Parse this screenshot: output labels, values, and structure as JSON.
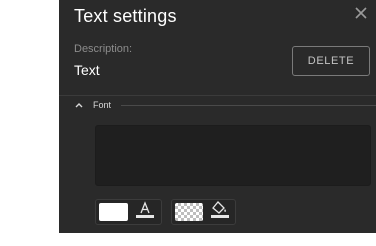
{
  "dialog": {
    "title": "Text settings",
    "close_icon": "close-icon"
  },
  "description": {
    "label": "Description:",
    "value": "Text"
  },
  "delete_button": {
    "label": "DELETE"
  },
  "font_section": {
    "label": "Font",
    "expanded": true,
    "chevron_icon": "chevron-up-icon"
  },
  "text_input": {
    "value": ""
  },
  "colors": {
    "panel_bg": "#2a2a2a",
    "text_color": "#ffffff",
    "background_color": "transparent"
  },
  "controls": {
    "text_color_icon": "text-color-icon",
    "fill_color_icon": "fill-color-icon"
  }
}
